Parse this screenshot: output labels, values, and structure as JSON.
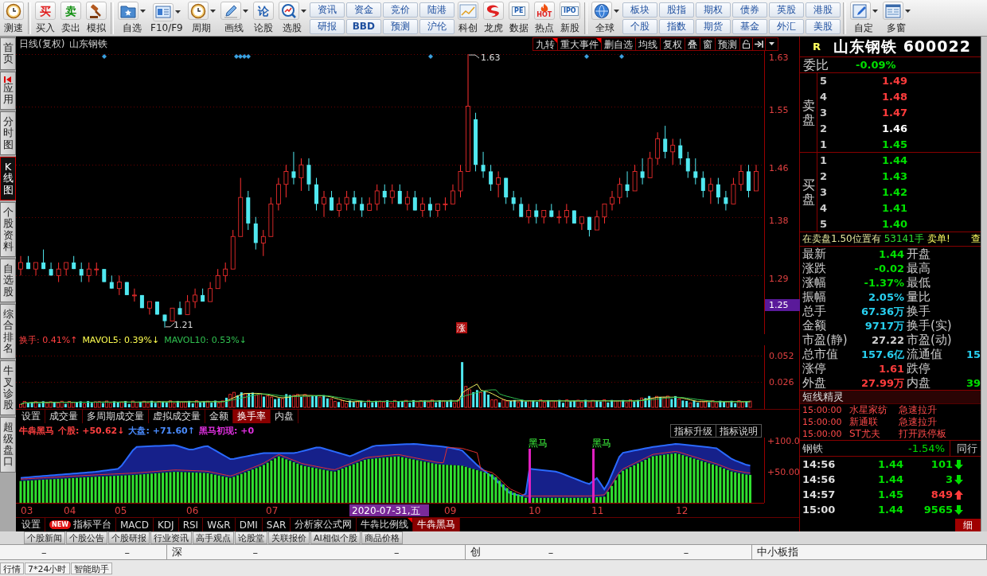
{
  "toolbar": [
    {
      "kind": "big",
      "label": "测速",
      "dropdown": false
    },
    {
      "kind": "sep"
    },
    {
      "kind": "big",
      "label": "买入",
      "glyph": "买",
      "dropdown": false
    },
    {
      "kind": "big",
      "label": "卖出",
      "glyph": "卖",
      "dropdown": false
    },
    {
      "kind": "big",
      "label": "模拟",
      "dropdown": false
    },
    {
      "kind": "sep"
    },
    {
      "kind": "big",
      "label": "自选",
      "dropdown": true
    },
    {
      "kind": "big",
      "label": "F10/F9",
      "dropdown": true
    },
    {
      "kind": "big",
      "label": "周期",
      "dropdown": true
    },
    {
      "kind": "big",
      "label": "画线",
      "dropdown": true
    },
    {
      "kind": "big",
      "label": "论股",
      "glyph": "论",
      "dropdown": false
    },
    {
      "kind": "big",
      "label": "选股",
      "dropdown": true
    },
    {
      "kind": "pair",
      "items": [
        {
          "label": "资讯",
          "bold": false
        },
        {
          "label": "研报",
          "bold": false
        }
      ]
    },
    {
      "kind": "pair",
      "items": [
        {
          "label": "资金",
          "bold": false
        },
        {
          "label": "BBD",
          "bold": true
        }
      ]
    },
    {
      "kind": "pair",
      "items": [
        {
          "label": "竞价",
          "bold": false
        },
        {
          "label": "预测",
          "bold": false
        }
      ]
    },
    {
      "kind": "pair",
      "items": [
        {
          "label": "陆港",
          "bold": false
        },
        {
          "label": "沪伦",
          "bold": false
        }
      ]
    },
    {
      "kind": "big",
      "label": "科创",
      "dropdown": false
    },
    {
      "kind": "big",
      "label": "龙虎",
      "dropdown": false
    },
    {
      "kind": "big",
      "label": "数据",
      "glyph": "PE",
      "dropdown": false
    },
    {
      "kind": "big",
      "label": "热点",
      "glyph": "HOT",
      "dropdown": false
    },
    {
      "kind": "big",
      "label": "新股",
      "glyph": "IPO",
      "dropdown": false
    },
    {
      "kind": "sep"
    },
    {
      "kind": "big",
      "label": "全球",
      "dropdown": true
    },
    {
      "kind": "pair",
      "items": [
        {
          "label": "板块",
          "bold": false
        },
        {
          "label": "个股",
          "bold": false
        }
      ]
    },
    {
      "kind": "pair",
      "items": [
        {
          "label": "股指",
          "bold": false
        },
        {
          "label": "指数",
          "bold": false
        }
      ]
    },
    {
      "kind": "pair",
      "items": [
        {
          "label": "期权",
          "bold": false
        },
        {
          "label": "期货",
          "bold": false
        }
      ]
    },
    {
      "kind": "pair",
      "items": [
        {
          "label": "债券",
          "bold": false
        },
        {
          "label": "基金",
          "bold": false
        }
      ]
    },
    {
      "kind": "pair",
      "items": [
        {
          "label": "英股",
          "bold": false
        },
        {
          "label": "外汇",
          "bold": false
        }
      ]
    },
    {
      "kind": "pair",
      "items": [
        {
          "label": "港股",
          "bold": false
        },
        {
          "label": "美股",
          "bold": false
        }
      ]
    },
    {
      "kind": "sep"
    },
    {
      "kind": "big",
      "label": "自定",
      "dropdown": true
    },
    {
      "kind": "big",
      "label": "多窗",
      "dropdown": true
    }
  ],
  "left_tabs": [
    {
      "label": "首页",
      "selected": false,
      "pinned": false
    },
    {
      "label": "应用",
      "selected": false,
      "pinned": true
    },
    {
      "label": "分时图",
      "selected": false,
      "pinned": false
    },
    {
      "label": "K线图",
      "selected": true,
      "pinned": false
    },
    {
      "label": "个股资料",
      "selected": false,
      "pinned": false
    },
    {
      "label": "自选股",
      "selected": false,
      "pinned": false
    },
    {
      "label": "综合排名",
      "selected": false,
      "pinned": false
    },
    {
      "label": "牛叉诊股",
      "selected": false,
      "pinned": false
    },
    {
      "label": "超级盘口",
      "selected": false,
      "pinned": false
    }
  ],
  "chart": {
    "period": "日线(复权)",
    "stock": "山东钢铁",
    "tools": [
      {
        "label": "九转",
        "flag": true
      },
      {
        "label": "重大事件",
        "flag": true
      },
      {
        "label": "删自选",
        "flag": false
      },
      {
        "label": "均线",
        "flag": false
      },
      {
        "label": "复权",
        "flag": false
      },
      {
        "label": "叠",
        "flag": false
      },
      {
        "label": "窗",
        "flag": false
      },
      {
        "label": "预测",
        "flag": false
      }
    ],
    "current_price": "1.25",
    "high_label": "1.63",
    "low_label": "1.21",
    "badge": "涨",
    "chart_data": {
      "type": "candlestick",
      "yticks": [
        1.63,
        1.55,
        1.46,
        1.38,
        1.29
      ],
      "ylim": [
        1.2,
        1.635
      ],
      "grid": true,
      "ohlc": [
        [
          1.3,
          1.32,
          1.29,
          1.31
        ],
        [
          1.31,
          1.32,
          1.3,
          1.3
        ],
        [
          1.3,
          1.31,
          1.29,
          1.31
        ],
        [
          1.31,
          1.33,
          1.3,
          1.3
        ],
        [
          1.3,
          1.31,
          1.29,
          1.29
        ],
        [
          1.29,
          1.31,
          1.28,
          1.3
        ],
        [
          1.3,
          1.31,
          1.29,
          1.31
        ],
        [
          1.31,
          1.32,
          1.3,
          1.3
        ],
        [
          1.3,
          1.31,
          1.28,
          1.29
        ],
        [
          1.29,
          1.31,
          1.28,
          1.3
        ],
        [
          1.3,
          1.31,
          1.29,
          1.3
        ],
        [
          1.3,
          1.3,
          1.28,
          1.28
        ],
        [
          1.28,
          1.29,
          1.27,
          1.27
        ],
        [
          1.27,
          1.29,
          1.26,
          1.28
        ],
        [
          1.28,
          1.28,
          1.26,
          1.26
        ],
        [
          1.26,
          1.27,
          1.25,
          1.26
        ],
        [
          1.26,
          1.26,
          1.24,
          1.24
        ],
        [
          1.24,
          1.25,
          1.23,
          1.25
        ],
        [
          1.25,
          1.25,
          1.23,
          1.23
        ],
        [
          1.23,
          1.23,
          1.21,
          1.22
        ],
        [
          1.22,
          1.24,
          1.22,
          1.24
        ],
        [
          1.24,
          1.25,
          1.23,
          1.23
        ],
        [
          1.23,
          1.26,
          1.23,
          1.25
        ],
        [
          1.25,
          1.27,
          1.24,
          1.26
        ],
        [
          1.26,
          1.27,
          1.25,
          1.25
        ],
        [
          1.25,
          1.28,
          1.25,
          1.27
        ],
        [
          1.27,
          1.3,
          1.27,
          1.29
        ],
        [
          1.29,
          1.31,
          1.28,
          1.3
        ],
        [
          1.3,
          1.36,
          1.3,
          1.35
        ],
        [
          1.35,
          1.44,
          1.35,
          1.41
        ],
        [
          1.41,
          1.42,
          1.36,
          1.37
        ],
        [
          1.37,
          1.38,
          1.33,
          1.34
        ],
        [
          1.34,
          1.36,
          1.32,
          1.35
        ],
        [
          1.35,
          1.41,
          1.35,
          1.4
        ],
        [
          1.4,
          1.44,
          1.39,
          1.43
        ],
        [
          1.43,
          1.46,
          1.41,
          1.45
        ],
        [
          1.45,
          1.48,
          1.43,
          1.44
        ],
        [
          1.44,
          1.47,
          1.42,
          1.46
        ],
        [
          1.46,
          1.47,
          1.42,
          1.43
        ],
        [
          1.43,
          1.44,
          1.39,
          1.4
        ],
        [
          1.4,
          1.42,
          1.38,
          1.41
        ],
        [
          1.41,
          1.42,
          1.39,
          1.39
        ],
        [
          1.39,
          1.41,
          1.38,
          1.4
        ],
        [
          1.4,
          1.42,
          1.39,
          1.41
        ],
        [
          1.41,
          1.42,
          1.39,
          1.4
        ],
        [
          1.4,
          1.41,
          1.38,
          1.39
        ],
        [
          1.39,
          1.41,
          1.39,
          1.4
        ],
        [
          1.4,
          1.43,
          1.39,
          1.42
        ],
        [
          1.42,
          1.43,
          1.4,
          1.41
        ],
        [
          1.41,
          1.43,
          1.4,
          1.42
        ],
        [
          1.42,
          1.43,
          1.4,
          1.4
        ],
        [
          1.4,
          1.42,
          1.39,
          1.41
        ],
        [
          1.41,
          1.42,
          1.39,
          1.39
        ],
        [
          1.39,
          1.41,
          1.38,
          1.4
        ],
        [
          1.4,
          1.41,
          1.38,
          1.39
        ],
        [
          1.39,
          1.4,
          1.38,
          1.4
        ],
        [
          1.4,
          1.41,
          1.39,
          1.4
        ],
        [
          1.4,
          1.43,
          1.4,
          1.42
        ],
        [
          1.42,
          1.46,
          1.41,
          1.45
        ],
        [
          1.45,
          1.63,
          1.45,
          1.55
        ],
        [
          1.53,
          1.54,
          1.45,
          1.46
        ],
        [
          1.46,
          1.48,
          1.44,
          1.45
        ],
        [
          1.45,
          1.46,
          1.42,
          1.43
        ],
        [
          1.43,
          1.45,
          1.41,
          1.44
        ],
        [
          1.44,
          1.44,
          1.4,
          1.41
        ],
        [
          1.41,
          1.42,
          1.39,
          1.4
        ],
        [
          1.4,
          1.41,
          1.38,
          1.38
        ],
        [
          1.38,
          1.4,
          1.37,
          1.39
        ],
        [
          1.39,
          1.4,
          1.37,
          1.38
        ],
        [
          1.38,
          1.39,
          1.37,
          1.39
        ],
        [
          1.39,
          1.4,
          1.38,
          1.38
        ],
        [
          1.38,
          1.39,
          1.37,
          1.38
        ],
        [
          1.38,
          1.4,
          1.37,
          1.39
        ],
        [
          1.39,
          1.39,
          1.37,
          1.37
        ],
        [
          1.37,
          1.38,
          1.36,
          1.38
        ],
        [
          1.38,
          1.38,
          1.35,
          1.36
        ],
        [
          1.36,
          1.39,
          1.36,
          1.38
        ],
        [
          1.38,
          1.4,
          1.37,
          1.4
        ],
        [
          1.4,
          1.42,
          1.39,
          1.41
        ],
        [
          1.41,
          1.44,
          1.4,
          1.43
        ],
        [
          1.43,
          1.45,
          1.41,
          1.42
        ],
        [
          1.42,
          1.46,
          1.42,
          1.45
        ],
        [
          1.45,
          1.47,
          1.43,
          1.44
        ],
        [
          1.44,
          1.48,
          1.44,
          1.47
        ],
        [
          1.47,
          1.51,
          1.46,
          1.5
        ],
        [
          1.5,
          1.52,
          1.47,
          1.48
        ],
        [
          1.48,
          1.5,
          1.46,
          1.49
        ],
        [
          1.49,
          1.5,
          1.46,
          1.47
        ],
        [
          1.47,
          1.48,
          1.44,
          1.45
        ],
        [
          1.45,
          1.47,
          1.43,
          1.44
        ],
        [
          1.44,
          1.45,
          1.41,
          1.42
        ],
        [
          1.42,
          1.44,
          1.4,
          1.43
        ],
        [
          1.43,
          1.44,
          1.4,
          1.41
        ],
        [
          1.41,
          1.42,
          1.39,
          1.4
        ],
        [
          1.4,
          1.44,
          1.4,
          1.43
        ],
        [
          1.43,
          1.46,
          1.42,
          1.45
        ],
        [
          1.45,
          1.46,
          1.41,
          1.42
        ],
        [
          1.42,
          1.46,
          1.42,
          1.45
        ]
      ]
    }
  },
  "volume": {
    "legend": [
      {
        "text": "换手: 0.41%↑",
        "color": "#ff4040"
      },
      {
        "text": "MAVOL5: 0.39%↓",
        "color": "#ffff50"
      },
      {
        "text": "MAVOL10: 0.53%↓",
        "color": "#30c050"
      }
    ],
    "ticks": [
      "0.052",
      "0.026"
    ],
    "tabs": [
      {
        "label": "设置",
        "selected": false
      },
      {
        "label": "成交量",
        "selected": false
      },
      {
        "label": "多周期成交量",
        "selected": false
      },
      {
        "label": "虚拟成交量",
        "selected": false
      },
      {
        "label": "金额",
        "selected": false
      },
      {
        "label": "换手率",
        "selected": true
      },
      {
        "label": "内盘",
        "selected": false
      }
    ]
  },
  "indicator": {
    "legend": [
      {
        "text": "牛犇黑马",
        "color": "#ff4040"
      },
      {
        "text": "个股: +50.62↓",
        "color": "#ff4040"
      },
      {
        "text": "大盘: +71.60↑",
        "color": "#4a8cff"
      },
      {
        "text": "黑马初现: +0",
        "color": "#e030e0"
      }
    ],
    "buttons": [
      "指标升级",
      "指标说明"
    ],
    "ticks": [
      "+100.0",
      "+50.00"
    ],
    "signals": [
      "黑马",
      "黑马"
    ],
    "months": [
      {
        "label": "03",
        "selected": false
      },
      {
        "label": "04",
        "selected": false
      },
      {
        "label": "05",
        "selected": false
      },
      {
        "label": "06",
        "selected": false
      },
      {
        "label": "07",
        "selected": false
      },
      {
        "label": "2020-07-31,五",
        "selected": true
      },
      {
        "label": "09",
        "selected": false
      },
      {
        "label": "10",
        "selected": false
      },
      {
        "label": "11",
        "selected": false
      },
      {
        "label": "12",
        "selected": false
      }
    ],
    "tabs": [
      {
        "label": "设置",
        "selected": false,
        "flag": false
      },
      {
        "label": "指标平台",
        "badge": "NEW",
        "selected": false,
        "flag": false
      },
      {
        "label": "MACD",
        "selected": false,
        "flag": false
      },
      {
        "label": "KDJ",
        "selected": false,
        "flag": false
      },
      {
        "label": "RSI",
        "selected": false,
        "flag": false
      },
      {
        "label": "W&R",
        "selected": false,
        "flag": false
      },
      {
        "label": "DMI",
        "selected": false,
        "flag": false
      },
      {
        "label": "SAR",
        "selected": false,
        "flag": false
      },
      {
        "label": "分析家公式网",
        "selected": false,
        "flag": false
      },
      {
        "label": "牛犇比例线",
        "selected": false,
        "flag": true
      },
      {
        "label": "牛犇黑马",
        "selected": true,
        "flag": false
      }
    ]
  },
  "quote": {
    "badge": "R",
    "name": "山东钢铁",
    "code": "600022",
    "ratio": {
      "label": "委比",
      "value": "-0.09%",
      "color": "#00e000"
    },
    "asks": {
      "label": "卖盘",
      "rows": [
        {
          "rank": "5",
          "price": "1.49",
          "color": "#ff3c3c"
        },
        {
          "rank": "4",
          "price": "1.48",
          "color": "#ff3c3c"
        },
        {
          "rank": "3",
          "price": "1.47",
          "color": "#ff3c3c"
        },
        {
          "rank": "2",
          "price": "1.46",
          "color": "#ffffff"
        },
        {
          "rank": "1",
          "price": "1.45",
          "color": "#00e000"
        }
      ]
    },
    "bids": {
      "label": "买盘",
      "rows": [
        {
          "rank": "1",
          "price": "1.44",
          "color": "#00e000"
        },
        {
          "rank": "2",
          "price": "1.43",
          "color": "#00e000"
        },
        {
          "rank": "3",
          "price": "1.42",
          "color": "#00e000"
        },
        {
          "rank": "4",
          "price": "1.41",
          "color": "#00e000"
        },
        {
          "rank": "5",
          "price": "1.40",
          "color": "#00e000"
        }
      ]
    },
    "notice": {
      "text": "在卖盘1.50位置有",
      "volume": "53141手",
      "suffix": "卖单!",
      "link": "查"
    },
    "stats": [
      {
        "left": {
          "label": "最新",
          "value": "1.44",
          "color": "#00e000"
        },
        "right": {
          "label": "开盘"
        }
      },
      {
        "left": {
          "label": "涨跌",
          "value": "-0.02",
          "color": "#00e000"
        },
        "right": {
          "label": "最高"
        }
      },
      {
        "left": {
          "label": "涨幅",
          "value": "-1.37%",
          "color": "#00e000"
        },
        "right": {
          "label": "最低"
        }
      },
      {
        "left": {
          "label": "振幅",
          "value": "2.05%",
          "color": "#28d0f0"
        },
        "right": {
          "label": "量比"
        }
      },
      {
        "left": {
          "label": "总手",
          "value": "67.36万",
          "color": "#28d0f0"
        },
        "right": {
          "label": "换手"
        }
      },
      {
        "left": {
          "label": "金额",
          "value": "9717万",
          "color": "#28d0f0"
        },
        "right": {
          "label": "换手(实)"
        }
      },
      {
        "left": {
          "label": "市盈(静)",
          "value": "27.22",
          "color": "#d0d0d0"
        },
        "right": {
          "label": "市盈(动)"
        }
      },
      {
        "left": {
          "label": "总市值",
          "value": "157.6亿",
          "color": "#28d0f0"
        },
        "right": {
          "label": "流通值",
          "value": "15",
          "color": "#28d0f0"
        }
      },
      {
        "left": {
          "label": "涨停",
          "value": "1.61",
          "color": "#ff3c3c"
        },
        "right": {
          "label": "跌停"
        }
      },
      {
        "left": {
          "label": "外盘",
          "value": "27.99万",
          "color": "#ff3c3c"
        },
        "right": {
          "label": "内盘",
          "value": "39",
          "color": "#00e000"
        }
      }
    ]
  },
  "alerts": {
    "title": "短线精灵",
    "rows": [
      {
        "time": "15:00:00",
        "stock": "水星家纺",
        "event": "急速拉升"
      },
      {
        "time": "15:00:00",
        "stock": "新通联",
        "event": "急速拉升"
      },
      {
        "time": "15:00:00",
        "stock": "ST尤夫",
        "event": "打开跌停板"
      }
    ]
  },
  "sector": {
    "name": "钢铁",
    "change": "-1.54%",
    "tab": "同行"
  },
  "ticks": [
    {
      "time": "14:56",
      "price": "1.44",
      "volume": "101",
      "kind": "sell",
      "color": "#00e000"
    },
    {
      "time": "14:56",
      "price": "1.44",
      "volume": "3",
      "kind": "sell",
      "color": "#00e000"
    },
    {
      "time": "14:57",
      "price": "1.45",
      "volume": "849",
      "kind": "buy",
      "color": "#ff3c3c"
    },
    {
      "time": "15:00",
      "price": "1.44",
      "volume": "9565",
      "kind": "sell",
      "color": "#00e000"
    }
  ],
  "detail_tab": "细",
  "news_tabs": [
    "个股新闻",
    "个股公告",
    "个股研报",
    "行业资讯",
    "高手观点",
    "论股堂",
    "关联报价",
    "AI相似个股",
    "商品价格"
  ],
  "status_bar": [
    {
      "values": [
        "–",
        "–"
      ]
    },
    {
      "label": "深",
      "values": [
        "–",
        "–"
      ]
    },
    {
      "label": "创",
      "values": [
        "–",
        "–"
      ]
    },
    {
      "label": "中小板指"
    }
  ],
  "footer_tabs": [
    "行情",
    "7*24小时",
    "智能助手"
  ]
}
